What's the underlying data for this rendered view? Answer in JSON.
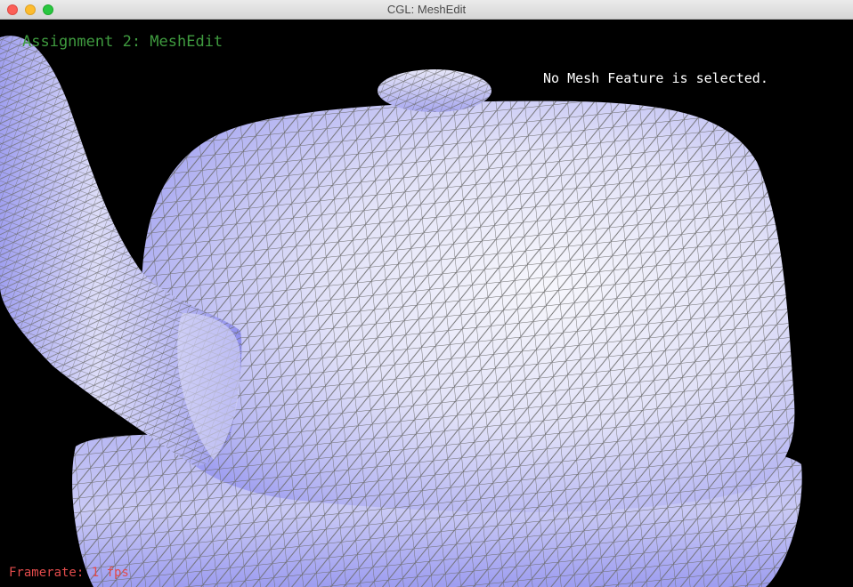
{
  "window": {
    "title": "CGL: MeshEdit"
  },
  "overlay": {
    "assignment_title": "Assignment 2: MeshEdit",
    "selection_status": "No Mesh Feature is selected.",
    "framerate": "Framerate: 1 fps"
  },
  "colors": {
    "background": "#000000",
    "title_text": "#3f9b3f",
    "status_text": "#ffffff",
    "framerate_text": "#e14b4b",
    "mesh_light": "#f4f4fb",
    "mesh_mid": "#c8c8f4",
    "mesh_dark": "#8c8cf0",
    "wireframe": "#6b6b6b"
  },
  "icons": {
    "close": "close-icon",
    "minimize": "minimize-icon",
    "maximize": "maximize-icon"
  }
}
